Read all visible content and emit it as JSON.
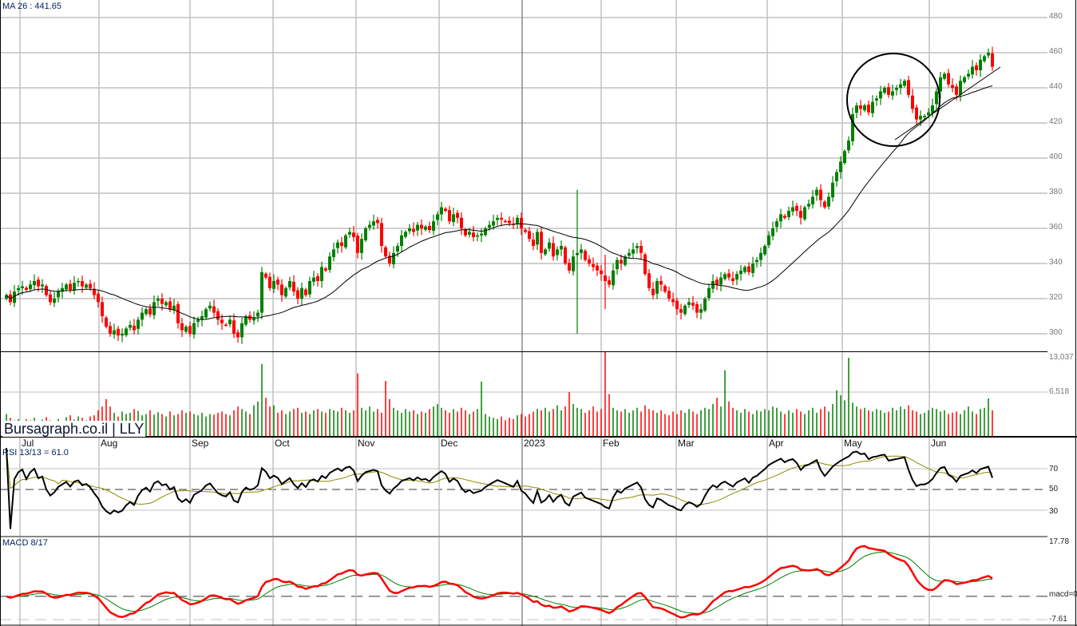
{
  "header": {
    "ma_label": "MA 26 : 441.65",
    "brand": "Bursagraph.co.il | LLY",
    "rsi_label": "RSI 13/13 = 61.0",
    "macd_label": "MACD 8/17"
  },
  "colors": {
    "up": "#008000",
    "down": "#ff0000",
    "ma": "#000000",
    "rsi": "#000000",
    "rsi_signal": "#8c8c00",
    "macd": "#ff0000",
    "macd_signal": "#008000"
  },
  "chart_data": {
    "type": "candlestick",
    "symbol": "LLY",
    "ma_period": 26,
    "price_axis": {
      "ticks": [
        300,
        320,
        340,
        360,
        380,
        400,
        420,
        440,
        460,
        480
      ],
      "labels": [
        "300",
        "320",
        "340",
        "360",
        "380",
        "400",
        "420",
        "440",
        "460",
        "480"
      ]
    },
    "volume_axis": {
      "labels": [
        "13,037",
        "6,518"
      ],
      "max": 13037
    },
    "rsi_axis": {
      "labels": [
        "70",
        "50",
        "30"
      ],
      "period": 13,
      "signal": 13
    },
    "macd_axis": {
      "labels": [
        "17.78",
        "macd=0",
        "-7.61"
      ],
      "range": [
        -7.61,
        17.78
      ],
      "fast": 8,
      "slow": 17,
      "signal": 9
    },
    "months": [
      {
        "label": "Jul",
        "start_index": 3.4
      },
      {
        "label": "Aug",
        "start_index": 23.2
      },
      {
        "label": "Sep",
        "start_index": 46
      },
      {
        "label": "Oct",
        "start_index": 66.8
      },
      {
        "label": "Nov",
        "start_index": 87.6
      },
      {
        "label": "Dec",
        "start_index": 108.4
      },
      {
        "label": "2023",
        "start_index": 129.2
      },
      {
        "label": "Feb",
        "start_index": 149
      },
      {
        "label": "Mar",
        "start_index": 167.8
      },
      {
        "label": "Apr",
        "start_index": 190.6
      },
      {
        "label": "May",
        "start_index": 209.4
      },
      {
        "label": "Jun",
        "start_index": 231.2
      }
    ],
    "close": [
      322,
      318,
      324,
      326,
      327,
      325,
      328,
      330,
      327,
      328,
      322,
      318,
      320,
      324,
      326,
      328,
      325,
      329,
      330,
      327,
      328,
      326,
      322,
      318,
      310,
      304,
      300,
      302,
      299,
      300,
      303,
      305,
      302,
      308,
      312,
      314,
      311,
      318,
      320,
      317,
      318,
      314,
      316,
      306,
      302,
      304,
      300,
      306,
      308,
      310,
      314,
      316,
      312,
      308,
      306,
      305,
      308,
      300,
      298,
      306,
      310,
      308,
      309,
      312,
      335,
      332,
      326,
      330,
      328,
      322,
      326,
      330,
      324,
      320,
      326,
      322,
      330,
      332,
      330,
      338,
      336,
      344,
      348,
      352,
      350,
      356,
      358,
      355,
      346,
      354,
      360,
      362,
      364,
      363,
      350,
      344,
      340,
      346,
      350,
      356,
      358,
      360,
      358,
      362,
      360,
      361,
      359,
      364,
      368,
      372,
      370,
      364,
      368,
      366,
      360,
      356,
      358,
      355,
      356,
      357,
      360,
      362,
      364,
      366,
      365,
      364,
      363,
      362,
      366,
      360,
      358,
      354,
      350,
      358,
      346,
      348,
      352,
      344,
      348,
      350,
      340,
      336,
      344,
      346,
      348,
      342,
      340,
      338,
      336,
      334,
      330,
      328,
      336,
      342,
      340,
      344,
      346,
      348,
      350,
      346,
      334,
      326,
      322,
      330,
      328,
      324,
      320,
      318,
      314,
      312,
      316,
      318,
      316,
      312,
      314,
      320,
      326,
      330,
      328,
      332,
      334,
      332,
      330,
      334,
      336,
      338,
      335,
      340,
      342,
      346,
      350,
      356,
      360,
      364,
      368,
      366,
      370,
      372,
      370,
      366,
      372,
      374,
      378,
      382,
      376,
      372,
      378,
      386,
      392,
      398,
      404,
      410,
      425,
      430,
      428,
      430,
      426,
      432,
      434,
      438,
      440,
      436,
      438,
      440,
      442,
      444,
      436,
      428,
      422,
      424,
      424,
      426,
      430,
      438,
      446,
      448,
      442,
      440,
      436,
      444,
      446,
      448,
      452,
      450,
      456,
      458,
      460,
      452
    ],
    "wick_overrides": {
      "143": [
        382,
        300
      ],
      "150": [
        345,
        314
      ]
    },
    "volume_thousands": [
      3.0,
      2.4,
      2.0,
      2.2,
      1.8,
      2.2,
      2.0,
      2.4,
      1.9,
      2.1,
      2.5,
      2.0,
      1.5,
      2.2,
      1.8,
      2.5,
      2.8,
      2.1,
      2.6,
      2.4,
      2.0,
      2.6,
      2.8,
      3.6,
      4.2,
      5.4,
      4.2,
      3.2,
      2.6,
      3.4,
      3.0,
      3.2,
      3.8,
      3.5,
      2.8,
      3.0,
      3.6,
      2.9,
      3.3,
      3.0,
      2.6,
      3.4,
      2.8,
      3.0,
      3.6,
      3.2,
      3.4,
      3.0,
      2.8,
      3.2,
      2.6,
      3.0,
      2.9,
      3.2,
      3.4,
      3.0,
      2.8,
      3.6,
      4.2,
      3.8,
      3.4,
      3.0,
      4.4,
      5.0,
      11.0,
      5.6,
      4.2,
      4.4,
      3.2,
      3.6,
      3.0,
      3.4,
      3.8,
      4.0,
      3.2,
      3.4,
      3.0,
      3.6,
      3.8,
      3.4,
      3.2,
      3.8,
      3.6,
      3.4,
      4.0,
      3.6,
      3.2,
      3.6,
      9.5,
      4.0,
      3.6,
      4.2,
      3.4,
      3.8,
      3.2,
      8.3,
      5.4,
      4.0,
      3.6,
      3.2,
      3.8,
      3.4,
      3.6,
      3.0,
      3.4,
      3.2,
      3.8,
      4.2,
      4.6,
      4.0,
      3.6,
      3.2,
      3.8,
      3.4,
      4.0,
      3.6,
      3.0,
      3.4,
      3.8,
      8.2,
      3.0,
      2.6,
      2.4,
      2.2,
      2.6,
      2.0,
      2.4,
      2.2,
      2.8,
      3.0,
      2.6,
      3.0,
      3.4,
      3.8,
      3.6,
      4.0,
      3.4,
      3.8,
      4.4,
      3.6,
      4.2,
      6.5,
      4.6,
      4.0,
      3.8,
      3.2,
      3.6,
      4.2,
      3.4,
      3.8,
      13.0,
      6.2,
      4.0,
      3.6,
      3.4,
      3.8,
      3.2,
      3.6,
      4.0,
      3.4,
      4.4,
      3.8,
      3.6,
      3.2,
      3.6,
      3.0,
      2.8,
      3.4,
      3.0,
      3.6,
      3.2,
      3.8,
      3.4,
      3.0,
      3.6,
      4.0,
      3.8,
      4.6,
      5.6,
      4.2,
      10.0,
      5.0,
      4.0,
      3.6,
      3.2,
      3.8,
      3.4,
      3.0,
      3.6,
      3.4,
      3.8,
      3.6,
      4.2,
      4.0,
      3.4,
      3.0,
      3.6,
      3.2,
      3.8,
      3.4,
      3.0,
      3.6,
      4.0,
      3.2,
      3.8,
      4.2,
      3.4,
      4.6,
      6.8,
      6.0,
      5.2,
      12.0,
      4.8,
      4.2,
      3.8,
      4.0,
      3.6,
      3.4,
      3.8,
      3.6,
      3.2,
      3.4,
      4.0,
      3.6,
      4.2,
      3.8,
      4.4,
      3.6,
      3.4,
      3.0,
      3.2,
      3.6,
      4.0,
      3.8,
      3.4,
      3.6,
      3.0,
      3.2,
      3.4,
      3.0,
      3.6,
      4.2,
      3.4,
      3.0,
      3.8,
      4.0,
      5.5,
      3.6
    ]
  }
}
